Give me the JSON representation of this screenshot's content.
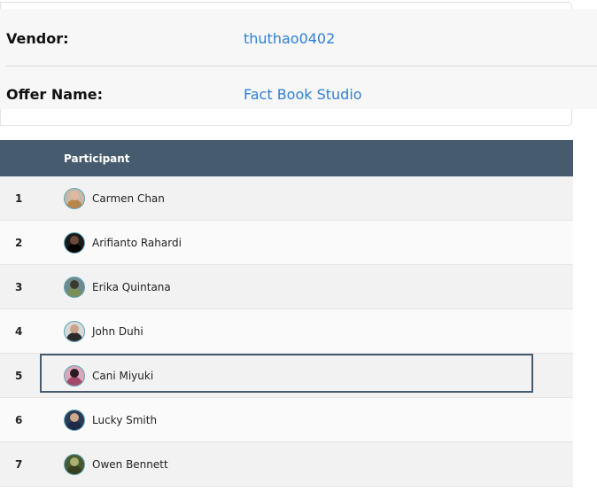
{
  "info": {
    "vendor_label": "Vendor:",
    "vendor_value": "thuthao0402",
    "offer_label": "Offer Name:",
    "offer_value": "Fact Book Studio"
  },
  "table": {
    "header": {
      "participant": "Participant"
    },
    "rows": [
      {
        "index": "1",
        "name": "Carmen Chan",
        "avatar_bg": "#c9b8a8",
        "head": "#e0b9a0",
        "body": "#b7864c"
      },
      {
        "index": "2",
        "name": "Arifianto Rahardi",
        "avatar_bg": "#1a1a1a",
        "head": "#6b4a3a",
        "body": "#000000"
      },
      {
        "index": "3",
        "name": "Erika Quintana",
        "avatar_bg": "#6f8a8c",
        "head": "#3b3a30",
        "body": "#7c8f58"
      },
      {
        "index": "4",
        "name": "John Duhi",
        "avatar_bg": "#d8d8d8",
        "head": "#caa28a",
        "body": "#2a2a2a"
      },
      {
        "index": "5",
        "name": "Cani Miyuki",
        "avatar_bg": "#dba6b8",
        "head": "#2a1a22",
        "body": "#a2486a"
      },
      {
        "index": "6",
        "name": "Lucky Smith",
        "avatar_bg": "#2c3a55",
        "head": "#d0a88a",
        "body": "#1e2a48"
      },
      {
        "index": "7",
        "name": "Owen Bennett",
        "avatar_bg": "#4a5a30",
        "head": "#a9b070",
        "body": "#36401e"
      }
    ],
    "selected_index": 5
  }
}
